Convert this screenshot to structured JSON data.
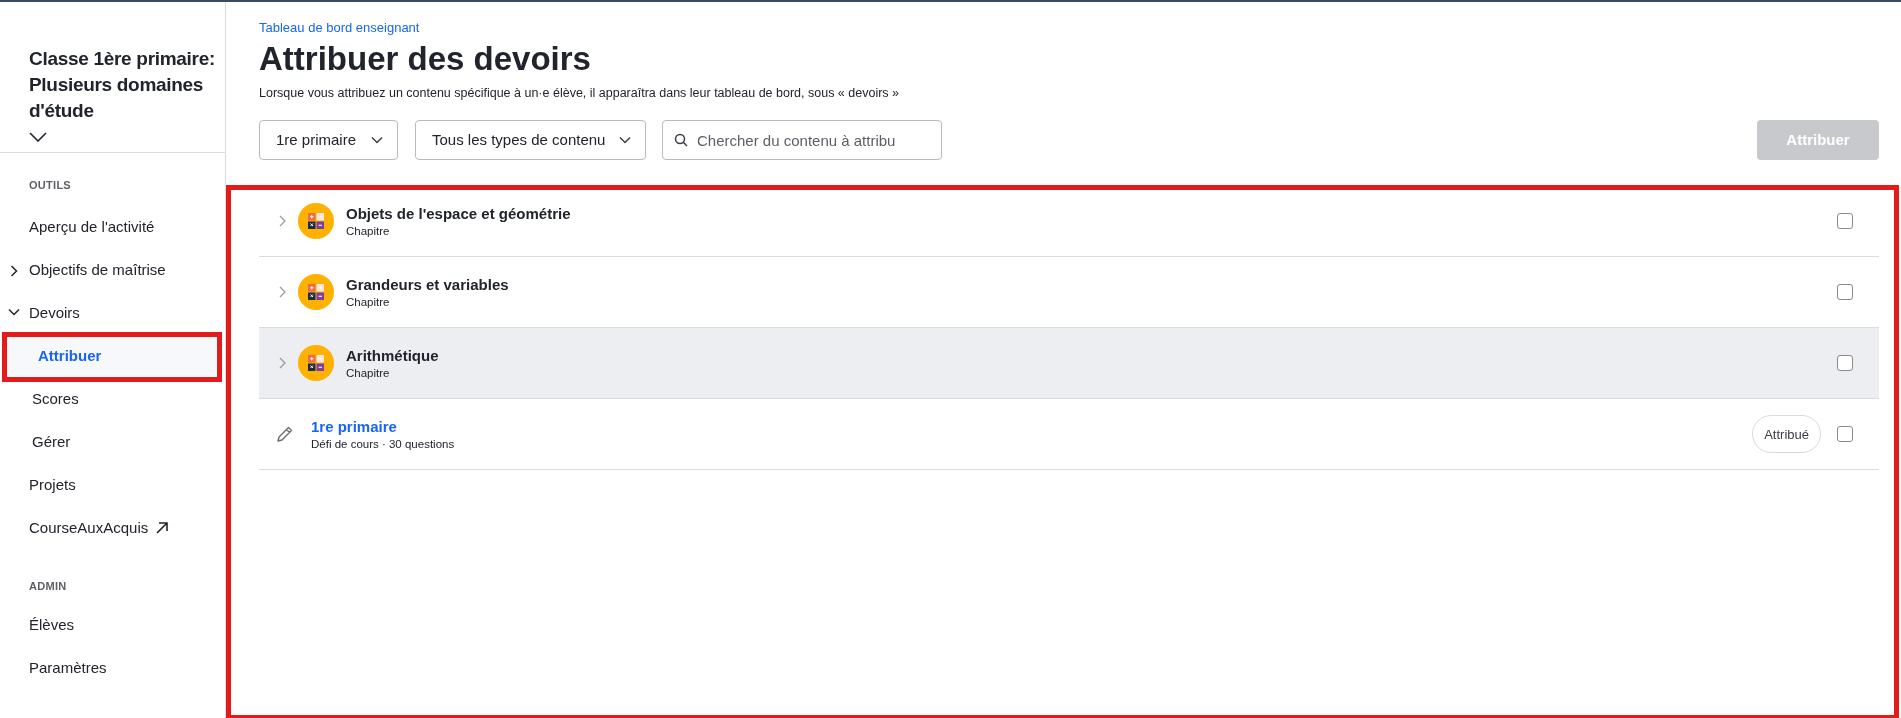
{
  "sidebar": {
    "course_title": "Classe 1ère primaire: Plusieurs domaines d'étude",
    "sections": [
      {
        "heading": "OUTILS",
        "items": [
          {
            "kind": "link",
            "label": "Aperçu de l'activité",
            "selected": false
          },
          {
            "kind": "group",
            "label": "Objectifs de maîtrise",
            "selected": false,
            "expanded": false
          },
          {
            "kind": "group",
            "label": "Devoirs",
            "selected": false,
            "expanded": true
          },
          {
            "kind": "subitem",
            "label": "Attribuer",
            "selected": true
          },
          {
            "kind": "subitem",
            "label": "Scores",
            "selected": false
          },
          {
            "kind": "subitem",
            "label": "Gérer",
            "selected": false
          },
          {
            "kind": "link",
            "label": "Projets",
            "selected": false
          },
          {
            "kind": "external",
            "label": "CourseAuxAcquis",
            "selected": false
          }
        ]
      },
      {
        "heading": "ADMIN",
        "items": [
          {
            "kind": "link",
            "label": "Élèves",
            "selected": false
          },
          {
            "kind": "link",
            "label": "Paramètres",
            "selected": false
          }
        ]
      }
    ]
  },
  "breadcrumb": "Tableau de bord enseignant",
  "title": "Attribuer des devoirs",
  "description": "Lorsque vous attribuez un contenu spécifique à un·e élève, il apparaîtra dans leur tableau de bord, sous « devoirs »",
  "filters": [
    {
      "value": "1re primaire"
    },
    {
      "value": "Tous les types de contenu"
    }
  ],
  "search": {
    "placeholder": "Chercher du contenu à attribu"
  },
  "assign_button": {
    "label": "Attribuer",
    "disabled": true
  },
  "content_rows": [
    {
      "kind": "chapter",
      "title": "Objets de l'espace et géométrie",
      "subtitle": "Chapitre",
      "hovered": false,
      "checked": false
    },
    {
      "kind": "chapter",
      "title": "Grandeurs et variables",
      "subtitle": "Chapitre",
      "hovered": false,
      "checked": false
    },
    {
      "kind": "chapter",
      "title": "Arithmétique",
      "subtitle": "Chapitre",
      "hovered": true,
      "checked": false
    },
    {
      "kind": "assignment",
      "title": "1re primaire",
      "subtitle": "Défi de cours · 30 questions",
      "badge": "Attribué",
      "hovered": false,
      "checked": false
    }
  ]
}
